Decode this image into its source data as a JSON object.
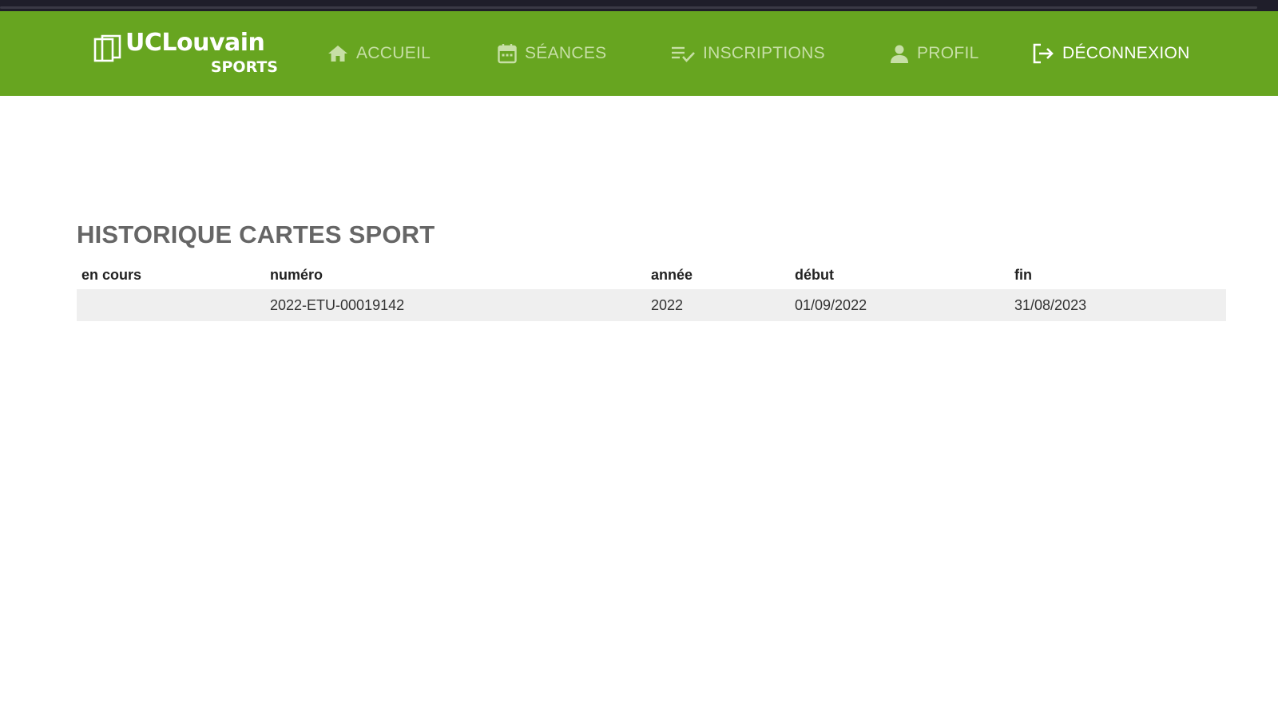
{
  "brand": {
    "name": "UCLouvain",
    "subtitle": "SPORTS"
  },
  "nav": {
    "items": [
      {
        "label": "ACCUEIL",
        "icon": "home-icon"
      },
      {
        "label": "SÉANCES",
        "icon": "calendar-icon"
      },
      {
        "label": "INSCRIPTIONS",
        "icon": "checklist-icon"
      },
      {
        "label": "PROFIL",
        "icon": "user-icon"
      },
      {
        "label": "DÉCONNEXION",
        "icon": "logout-icon"
      }
    ]
  },
  "main": {
    "title": "HISTORIQUE CARTES SPORT",
    "table": {
      "columns": [
        "en cours",
        "numéro",
        "année",
        "début",
        "fin"
      ],
      "rows": [
        [
          "",
          "2022-ETU-00019142",
          "2022",
          "01/09/2022",
          "31/08/2023"
        ]
      ]
    }
  },
  "colors": {
    "navbar": "#67a520",
    "nav_text": "#c7dfa6",
    "nav_active_text": "#ffffff",
    "title_text": "#666666",
    "row_background": "#efefef"
  }
}
